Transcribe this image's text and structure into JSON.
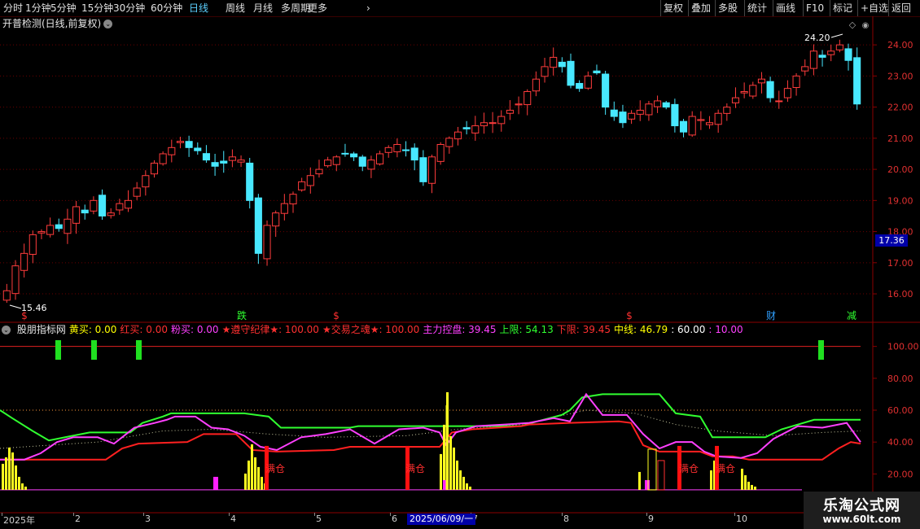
{
  "toolbar": {
    "left": [
      "分时",
      "1分钟",
      "5分钟",
      "15分钟",
      "30分钟",
      "60分钟",
      "日线",
      "周线",
      "月线",
      "多周期",
      "更多"
    ],
    "active": "日线",
    "right": [
      "复权",
      "叠加",
      "多股",
      "统计",
      "画线",
      "F10",
      "标记",
      "+自选",
      "返回"
    ]
  },
  "main_panel": {
    "title": "开普检测(日线,前复权)",
    "high_label": "24.20",
    "low_label": "15.46",
    "last_price": "17.36",
    "y_ticks": [
      "24.00",
      "23.00",
      "22.00",
      "21.00",
      "20.00",
      "19.00",
      "18.00",
      "17.00",
      "16.00"
    ],
    "markers": [
      {
        "text": "$",
        "color": "#ff3030"
      },
      {
        "text": "跌",
        "color": "#30ff30"
      },
      {
        "text": "$",
        "color": "#ff3030"
      },
      {
        "text": "$",
        "color": "#ff3030"
      },
      {
        "text": "财",
        "color": "#30a0ff"
      },
      {
        "text": "减",
        "color": "#30ff30"
      }
    ]
  },
  "indicator_panel": {
    "name": "股朋指标网",
    "fields": [
      {
        "label": "黄买: 0.00",
        "color": "#ffff00"
      },
      {
        "label": "红买: 0.00",
        "color": "#ff3030"
      },
      {
        "label": "粉买: 0.00",
        "color": "#ff40ff"
      },
      {
        "label": "★遵守纪律★: 100.00",
        "color": "#ff3030"
      },
      {
        "label": "★交易之魂★: 100.00",
        "color": "#ff3030"
      },
      {
        "label": "主力控盘: 39.45",
        "color": "#ff40ff"
      },
      {
        "label": "上限: 54.13",
        "color": "#30ff30"
      },
      {
        "label": "下限: 39.45",
        "color": "#ff3030"
      },
      {
        "label": "中线: 46.79",
        "color": "#ffff00"
      },
      {
        "label": ": 60.00",
        "color": "#ffffff"
      },
      {
        "label": ": 10.00",
        "color": "#ff40ff"
      }
    ],
    "y_ticks": [
      "100.00",
      "80.00",
      "60.00",
      "40.00",
      "20.00"
    ],
    "full_pos_label": "满仓"
  },
  "time_axis": {
    "labels": [
      "2025年",
      "2",
      "3",
      "4",
      "5",
      "6",
      "7",
      "8",
      "9",
      "10"
    ],
    "cursor_date": "2025/06/09/一"
  },
  "watermark": {
    "title": "乐淘公式网",
    "url": "www.60lt.com"
  },
  "chart_data": {
    "type": "candlestick",
    "ohlc_close_series": [
      16.1,
      16.9,
      17.3,
      17.9,
      18.0,
      18.2,
      18.1,
      18.4,
      18.8,
      18.6,
      19.0,
      18.5,
      18.6,
      18.9,
      19.0,
      19.4,
      19.8,
      20.2,
      20.5,
      20.7,
      20.9,
      20.7,
      20.6,
      20.3,
      20.1,
      20.2,
      20.4,
      20.3,
      19.0,
      17.3,
      18.2,
      18.6,
      18.9,
      19.2,
      19.6,
      19.8,
      20.0,
      20.3,
      20.4,
      20.5,
      20.4,
      20.1,
      20.3,
      20.5,
      20.7,
      20.8,
      20.6,
      20.3,
      19.6,
      20.4,
      20.8,
      21.0,
      21.2,
      21.3,
      21.4,
      21.5,
      21.5,
      21.7,
      21.9,
      22.1,
      22.5,
      22.9,
      23.3,
      23.6,
      23.3,
      22.7,
      22.6,
      23.0,
      23.1,
      22.0,
      21.7,
      21.5,
      21.8,
      21.9,
      22.1,
      22.2,
      22.0,
      21.4,
      21.2,
      21.7,
      21.6,
      21.5,
      21.8,
      22.0,
      22.3,
      22.5,
      22.7,
      22.9,
      22.3,
      22.2,
      22.6,
      23.0,
      23.3,
      23.8,
      23.6,
      23.8,
      24.0,
      23.5,
      22.1
    ],
    "ylim": [
      15.4,
      24.5
    ]
  }
}
